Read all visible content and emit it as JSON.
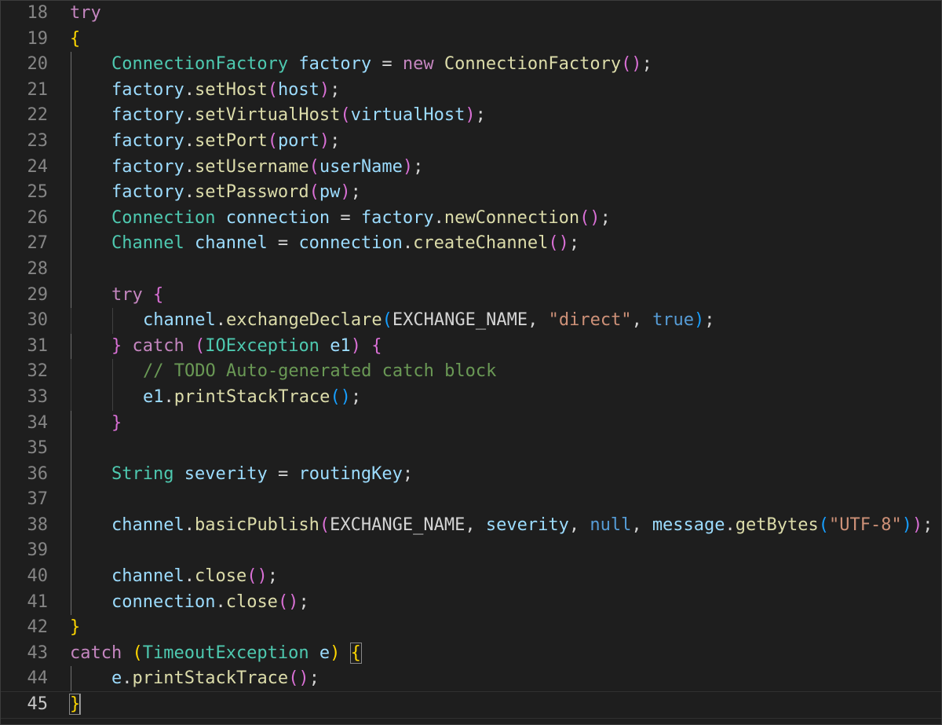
{
  "colors": {
    "background": "#1e1e1e",
    "keyword_control": "#c586c0",
    "keyword": "#569cd6",
    "type": "#4ec9b0",
    "variable": "#9cdcfe",
    "function": "#dcdcaa",
    "string": "#ce9178",
    "comment": "#6a9955",
    "constant": "#4fc1ff",
    "plain": "#d4d4d4",
    "bracket_gold": "#ffd700",
    "bracket_purple": "#da70d6",
    "bracket_blue": "#179fff"
  },
  "cursor": {
    "line": 45
  },
  "lines": [
    {
      "num": "18",
      "indent": 0,
      "tokens": [
        [
          "try",
          "keyword_control"
        ]
      ]
    },
    {
      "num": "19",
      "indent": 0,
      "tokens": [
        [
          "{",
          "bracket_gold"
        ]
      ]
    },
    {
      "num": "20",
      "indent": 1,
      "tokens": [
        [
          "ConnectionFactory",
          "type"
        ],
        [
          " ",
          "plain"
        ],
        [
          "factory",
          "variable"
        ],
        [
          " = ",
          "plain"
        ],
        [
          "new",
          "keyword_control"
        ],
        [
          " ",
          "plain"
        ],
        [
          "ConnectionFactory",
          "function"
        ],
        [
          "()",
          "bracket_purple"
        ],
        [
          ";",
          "plain"
        ]
      ]
    },
    {
      "num": "21",
      "indent": 1,
      "tokens": [
        [
          "factory",
          "variable"
        ],
        [
          ".",
          "plain"
        ],
        [
          "setHost",
          "function"
        ],
        [
          "(",
          "bracket_purple"
        ],
        [
          "host",
          "variable"
        ],
        [
          ")",
          "bracket_purple"
        ],
        [
          ";",
          "plain"
        ]
      ]
    },
    {
      "num": "22",
      "indent": 1,
      "tokens": [
        [
          "factory",
          "variable"
        ],
        [
          ".",
          "plain"
        ],
        [
          "setVirtualHost",
          "function"
        ],
        [
          "(",
          "bracket_purple"
        ],
        [
          "virtualHost",
          "variable"
        ],
        [
          ")",
          "bracket_purple"
        ],
        [
          ";",
          "plain"
        ]
      ]
    },
    {
      "num": "23",
      "indent": 1,
      "tokens": [
        [
          "factory",
          "variable"
        ],
        [
          ".",
          "plain"
        ],
        [
          "setPort",
          "function"
        ],
        [
          "(",
          "bracket_purple"
        ],
        [
          "port",
          "variable"
        ],
        [
          ")",
          "bracket_purple"
        ],
        [
          ";",
          "plain"
        ]
      ]
    },
    {
      "num": "24",
      "indent": 1,
      "tokens": [
        [
          "factory",
          "variable"
        ],
        [
          ".",
          "plain"
        ],
        [
          "setUsername",
          "function"
        ],
        [
          "(",
          "bracket_purple"
        ],
        [
          "userName",
          "variable"
        ],
        [
          ")",
          "bracket_purple"
        ],
        [
          ";",
          "plain"
        ]
      ]
    },
    {
      "num": "25",
      "indent": 1,
      "tokens": [
        [
          "factory",
          "variable"
        ],
        [
          ".",
          "plain"
        ],
        [
          "setPassword",
          "function"
        ],
        [
          "(",
          "bracket_purple"
        ],
        [
          "pw",
          "variable"
        ],
        [
          ")",
          "bracket_purple"
        ],
        [
          ";",
          "plain"
        ]
      ]
    },
    {
      "num": "26",
      "indent": 1,
      "tokens": [
        [
          "Connection",
          "type"
        ],
        [
          " ",
          "plain"
        ],
        [
          "connection",
          "variable"
        ],
        [
          " = ",
          "plain"
        ],
        [
          "factory",
          "variable"
        ],
        [
          ".",
          "plain"
        ],
        [
          "newConnection",
          "function"
        ],
        [
          "()",
          "bracket_purple"
        ],
        [
          ";",
          "plain"
        ]
      ]
    },
    {
      "num": "27",
      "indent": 1,
      "tokens": [
        [
          "Channel",
          "type"
        ],
        [
          " ",
          "plain"
        ],
        [
          "channel",
          "variable"
        ],
        [
          " = ",
          "plain"
        ],
        [
          "connection",
          "variable"
        ],
        [
          ".",
          "plain"
        ],
        [
          "createChannel",
          "function"
        ],
        [
          "()",
          "bracket_purple"
        ],
        [
          ";",
          "plain"
        ]
      ]
    },
    {
      "num": "28",
      "indent": 1,
      "tokens": []
    },
    {
      "num": "29",
      "indent": 1,
      "tokens": [
        [
          "try",
          "keyword_control"
        ],
        [
          " ",
          "plain"
        ],
        [
          "{",
          "bracket_purple"
        ]
      ]
    },
    {
      "num": "30",
      "indent": 2,
      "tokens": [
        [
          "channel",
          "variable"
        ],
        [
          ".",
          "plain"
        ],
        [
          "exchangeDeclare",
          "function"
        ],
        [
          "(",
          "bracket_blue"
        ],
        [
          "EXCHANGE_NAME",
          "plain"
        ],
        [
          ", ",
          "plain"
        ],
        [
          "\"direct\"",
          "string"
        ],
        [
          ", ",
          "plain"
        ],
        [
          "true",
          "keyword"
        ],
        [
          ")",
          "bracket_blue"
        ],
        [
          ";",
          "plain"
        ]
      ]
    },
    {
      "num": "31",
      "indent": 1,
      "tokens": [
        [
          "}",
          "bracket_purple"
        ],
        [
          " ",
          "plain"
        ],
        [
          "catch",
          "keyword_control"
        ],
        [
          " ",
          "plain"
        ],
        [
          "(",
          "bracket_purple"
        ],
        [
          "IOException",
          "type"
        ],
        [
          " ",
          "plain"
        ],
        [
          "e1",
          "variable"
        ],
        [
          ")",
          "bracket_purple"
        ],
        [
          " ",
          "plain"
        ],
        [
          "{",
          "bracket_purple"
        ]
      ]
    },
    {
      "num": "32",
      "indent": 2,
      "tokens": [
        [
          "// TODO Auto-generated catch block",
          "comment"
        ]
      ]
    },
    {
      "num": "33",
      "indent": 2,
      "tokens": [
        [
          "e1",
          "variable"
        ],
        [
          ".",
          "plain"
        ],
        [
          "printStackTrace",
          "function"
        ],
        [
          "()",
          "bracket_blue"
        ],
        [
          ";",
          "plain"
        ]
      ]
    },
    {
      "num": "34",
      "indent": 1,
      "tokens": [
        [
          "}",
          "bracket_purple"
        ]
      ]
    },
    {
      "num": "35",
      "indent": 1,
      "tokens": []
    },
    {
      "num": "36",
      "indent": 1,
      "tokens": [
        [
          "String",
          "type"
        ],
        [
          " ",
          "plain"
        ],
        [
          "severity",
          "variable"
        ],
        [
          " = ",
          "plain"
        ],
        [
          "routingKey",
          "variable"
        ],
        [
          ";",
          "plain"
        ]
      ]
    },
    {
      "num": "37",
      "indent": 1,
      "tokens": []
    },
    {
      "num": "38",
      "indent": 1,
      "tokens": [
        [
          "channel",
          "variable"
        ],
        [
          ".",
          "plain"
        ],
        [
          "basicPublish",
          "function"
        ],
        [
          "(",
          "bracket_purple"
        ],
        [
          "EXCHANGE_NAME",
          "plain"
        ],
        [
          ", ",
          "plain"
        ],
        [
          "severity",
          "variable"
        ],
        [
          ", ",
          "plain"
        ],
        [
          "null",
          "keyword"
        ],
        [
          ", ",
          "plain"
        ],
        [
          "message",
          "variable"
        ],
        [
          ".",
          "plain"
        ],
        [
          "getBytes",
          "function"
        ],
        [
          "(",
          "bracket_blue"
        ],
        [
          "\"UTF-8\"",
          "string"
        ],
        [
          ")",
          "bracket_blue"
        ],
        [
          ")",
          "bracket_purple"
        ],
        [
          ";",
          "plain"
        ]
      ]
    },
    {
      "num": "39",
      "indent": 1,
      "tokens": []
    },
    {
      "num": "40",
      "indent": 1,
      "tokens": [
        [
          "channel",
          "variable"
        ],
        [
          ".",
          "plain"
        ],
        [
          "close",
          "function"
        ],
        [
          "()",
          "bracket_purple"
        ],
        [
          ";",
          "plain"
        ]
      ]
    },
    {
      "num": "41",
      "indent": 1,
      "tokens": [
        [
          "connection",
          "variable"
        ],
        [
          ".",
          "plain"
        ],
        [
          "close",
          "function"
        ],
        [
          "()",
          "bracket_purple"
        ],
        [
          ";",
          "plain"
        ]
      ]
    },
    {
      "num": "42",
      "indent": 0,
      "tokens": [
        [
          "}",
          "bracket_gold"
        ]
      ]
    },
    {
      "num": "43",
      "indent": 0,
      "tokens": [
        [
          "catch",
          "keyword_control"
        ],
        [
          " ",
          "plain"
        ],
        [
          "(",
          "bracket_gold"
        ],
        [
          "TimeoutException",
          "type"
        ],
        [
          " ",
          "plain"
        ],
        [
          "e",
          "variable"
        ],
        [
          ")",
          "bracket_gold"
        ],
        [
          " ",
          "plain"
        ],
        [
          "{",
          "bracket_gold",
          "match"
        ]
      ]
    },
    {
      "num": "44",
      "indent": 1,
      "tokens": [
        [
          "e",
          "variable"
        ],
        [
          ".",
          "plain"
        ],
        [
          "printStackTrace",
          "function"
        ],
        [
          "()",
          "bracket_purple"
        ],
        [
          ";",
          "plain"
        ]
      ]
    },
    {
      "num": "45",
      "indent": 0,
      "tokens": [
        [
          "}",
          "bracket_gold",
          "match"
        ]
      ]
    }
  ]
}
